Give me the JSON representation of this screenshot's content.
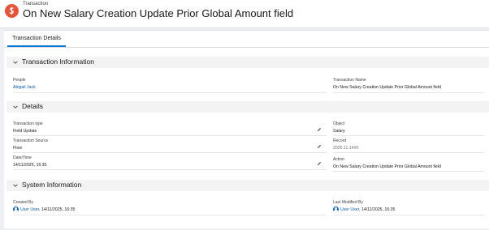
{
  "header": {
    "object_type": "Transaction",
    "title": "On New Salary Creation Update Prior Global Amount field",
    "icon": "transaction-icon",
    "icon_color": "#e4563b"
  },
  "tabs": [
    {
      "label": "Transaction Details",
      "active": true
    }
  ],
  "sections": {
    "transaction_info": {
      "title": "Transaction Information",
      "people_label": "People",
      "people_value": "Abigail Jack",
      "name_label": "Transaction Name",
      "name_value": "On New Salary Creation Update Prior Global Amount field"
    },
    "details": {
      "title": "Details",
      "type_label": "Transaction type",
      "type_value": "Field Update",
      "source_label": "Transaction Source",
      "source_value": "Flow",
      "datetime_label": "Date/Time",
      "datetime_value": "14/11/2025, 16:35",
      "object_label": "Object",
      "object_value": "Salary",
      "record_label": "Record",
      "record_value": "2025.11.14#0",
      "action_label": "Action",
      "action_value": "On New Salary Creation Update Prior Global Amount field"
    },
    "system_info": {
      "title": "System Information",
      "created_label": "Created By",
      "created_user": "User User",
      "created_date": ", 14/11/2025, 16:35",
      "modified_label": "Last Modified By",
      "modified_user": "User User",
      "modified_date": ", 14/11/2025, 16:35"
    }
  },
  "colors": {
    "link": "#0b5cab",
    "tab_active": "#0176d3",
    "section_bg": "#f3f3f3"
  }
}
